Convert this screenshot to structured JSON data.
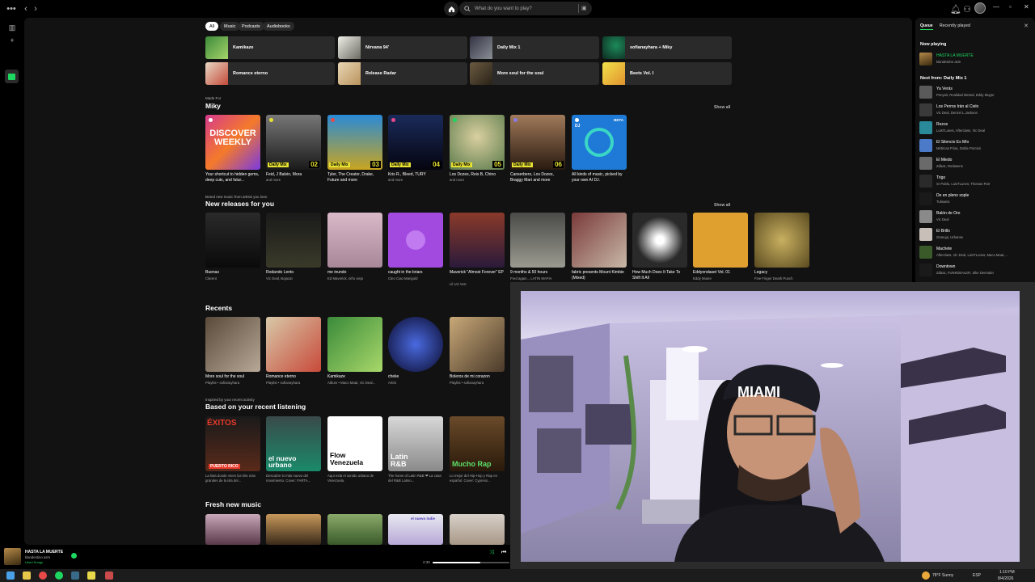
{
  "topbar": {
    "search_placeholder": "What do you want to play?",
    "icons": [
      "menu-dots-icon",
      "back-icon",
      "forward-icon",
      "home-icon",
      "search-icon",
      "browse-icon",
      "bell-icon",
      "friends-icon",
      "avatar"
    ]
  },
  "main": {
    "filters": [
      "All",
      "Music",
      "Podcasts",
      "Audiobooks"
    ],
    "quick_tiles": [
      {
        "label": "Kamikaze"
      },
      {
        "label": "Nirvana 94'"
      },
      {
        "label": "Daily Mix 1"
      },
      {
        "label": "sofianayhara + Miky"
      },
      {
        "label": "Romance eterno"
      },
      {
        "label": "Release Radar"
      },
      {
        "label": "More soul for the soul"
      },
      {
        "label": "Beets Vol. I"
      }
    ],
    "made_for": {
      "small": "Made For",
      "title": "Miky",
      "show_all": "Show all",
      "cards": [
        {
          "title": "Your shortcut to hidden gems, deep cuts, and futur...",
          "sub": "",
          "art_text": "DISCOVER WEEKLY"
        },
        {
          "title": "Feid, J Balvin, Mora",
          "sub": "and more",
          "num": "02",
          "badge": "Daily Mix"
        },
        {
          "title": "Tyler, The Creator, Drake, Future and more",
          "sub": "",
          "num": "03",
          "badge": "Daily Mix"
        },
        {
          "title": "Kris R., Bleed, TURY",
          "sub": "and more",
          "num": "04",
          "badge": "Daily Mix"
        },
        {
          "title": "Los Dozes, Reis B, Chino",
          "sub": "and more",
          "num": "05",
          "badge": "Daily Mix"
        },
        {
          "title": "Canserbero, Los Dozes, Braggy Mari and more",
          "sub": "",
          "num": "06",
          "badge": "Daily Mix"
        },
        {
          "title": "All kinds of music, picked by your own AI DJ.",
          "sub": "",
          "badge_dj": "DJ",
          "beta": "BETA"
        }
      ]
    },
    "new_releases": {
      "small": "Brand new music from artists you love.",
      "title": "New releases for you",
      "show_all": "Show all",
      "cards": [
        {
          "title": "Buenas",
          "sub": "Clarent"
        },
        {
          "title": "Rodando Lento",
          "sub": "Vic Deal, Bojacat"
        },
        {
          "title": "me inundo",
          "sub": "Ed Maverick, niño viejo"
        },
        {
          "title": "caught in the briars",
          "sub": "Cleo Ciao Marigold"
        },
        {
          "title": "Maverick \"Almost Forever\" EP",
          "sub": "Lil Uzi Vert"
        },
        {
          "title": "9 months & 50 hours",
          "sub": "Fred again.., LATIN MAFIA"
        },
        {
          "title": "fabric presents Mount Kimbie (Mixed)",
          "sub": ""
        },
        {
          "title": "How Much Does It Take To Shift It All",
          "sub": ""
        },
        {
          "title": "Eddyondaset Vol. 01",
          "sub": "Eddy Musre"
        },
        {
          "title": "Legacy",
          "sub": "Five Finger Death Punch"
        }
      ]
    },
    "recents": {
      "title": "Recents",
      "cards": [
        {
          "title": "More soul for the soul",
          "sub": "Playlist • sofianayhara"
        },
        {
          "title": "Romance eterno",
          "sub": "Playlist • sofianayhara"
        },
        {
          "title": "Kamikaze",
          "sub": "Album • Maco Maat, Vic Deal..."
        },
        {
          "title": "cheke",
          "sub": "Artist"
        },
        {
          "title": "Boleros de mi corazon",
          "sub": "Playlist • sofianayhara"
        }
      ]
    },
    "based_on": {
      "small": "Inspired by your recent activity",
      "title": "Based on your recent listening",
      "cards": [
        {
          "title": "La lista donde viven los hits más grandes de la isla del...",
          "art_text": "ÉXITOS",
          "art_sub": "PUERTO RICO"
        },
        {
          "title": "Descubre lo más nuevo del movimiento. Cover: FARTA...",
          "art_text": "el nuevo urbano"
        },
        {
          "title": "Aquí está el sonido urbano de Venezuela.",
          "art_text": "Flow Venezuela"
        },
        {
          "title": "The home of Latin R&B ❤ La casa del R&B Latino...",
          "art_text": "Latin R&B"
        },
        {
          "title": "Lo mejor del Hip-Hop y Rap en español. Cover: Cypress...",
          "art_text": "Mucho Rap"
        }
      ]
    },
    "fresh": {
      "title": "Fresh new music",
      "mini_label": "el nuevo indie"
    }
  },
  "queue": {
    "tabs": [
      "Queue",
      "Recently played"
    ],
    "now_playing_label": "Now playing",
    "now_playing": {
      "title": "HASTA LA MUERTE",
      "artist": "klandestino asm"
    },
    "next_from_label": "Next from: Daily Mix 1",
    "items": [
      {
        "title": "Ya Verás",
        "artist": "Penyair, Realidad Mental, Eddy Mugre"
      },
      {
        "title": "Los Perros Irán al Cielo",
        "artist": "Vic Deal, Denzel L.Jackson"
      },
      {
        "title": "Rezos",
        "artist": "LuisTLunes, Afterclass, Vic Deal"
      },
      {
        "title": "El Silencio Es Mío",
        "artist": "Métricas Frías, Doble Porcion"
      },
      {
        "title": "El Miedo",
        "artist": "Zábaz, Rodasens"
      },
      {
        "title": "Trigo",
        "artist": "Sr Pablo, LuisTLunes, Thomas Parr"
      },
      {
        "title": "De en pleno sople",
        "artist": "Tulisantx"
      },
      {
        "title": "Balón de Oro",
        "artist": "Vic Deal"
      },
      {
        "title": "El Brillo",
        "artist": "Granuja, Urbanse"
      },
      {
        "title": "Machete",
        "artist": "Afterclass, Vic Deal, LuisTLunes, Maco Maat,..."
      },
      {
        "title": "Downtown",
        "artist": "Zábaz, FUNKDEALER, Sike Demoder"
      }
    ]
  },
  "player": {
    "title": "HASTA LA MUERTE",
    "artist": "klandestino asm",
    "liked": "Liked Songs",
    "time_current": "2:30",
    "progress": 0.62
  },
  "taskbar": {
    "weather": "78°F  Sunny",
    "lang": "ESP",
    "time": "1:10 PM",
    "date": "8/4/2026"
  },
  "colors": {
    "accent": "#1ed760",
    "background": "#121212",
    "surface": "#2a2a2a"
  }
}
